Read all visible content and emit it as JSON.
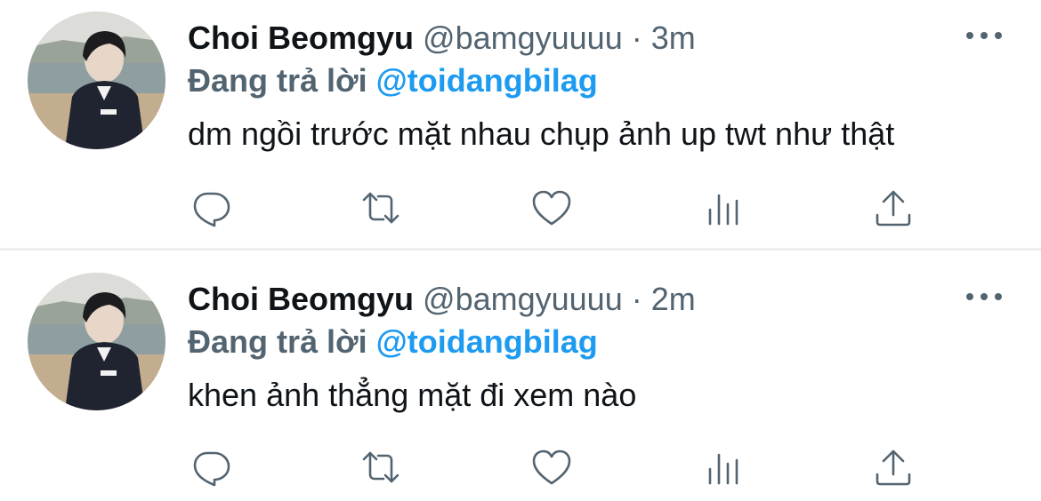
{
  "colors": {
    "text_primary": "#0f1419",
    "text_secondary": "#536471",
    "accent": "#1d9bf0",
    "divider": "#eceef0"
  },
  "tweets": [
    {
      "display_name": "Choi Beomgyu",
      "handle": "@bamgyuuuu",
      "separator": "·",
      "time": "3m",
      "reply_prefix": "Đang trả lời",
      "reply_to": "@toidangbilag",
      "text": "dm ngồi trước mặt nhau chụp ảnh up twt như thật",
      "actions": [
        "reply-icon",
        "retweet-icon",
        "like-icon",
        "analytics-icon",
        "share-icon"
      ]
    },
    {
      "display_name": "Choi Beomgyu",
      "handle": "@bamgyuuuu",
      "separator": "·",
      "time": "2m",
      "reply_prefix": "Đang trả lời",
      "reply_to": "@toidangbilag",
      "text": "khen ảnh thẳng mặt đi xem nào",
      "actions": [
        "reply-icon",
        "retweet-icon",
        "like-icon",
        "analytics-icon",
        "share-icon"
      ]
    }
  ]
}
